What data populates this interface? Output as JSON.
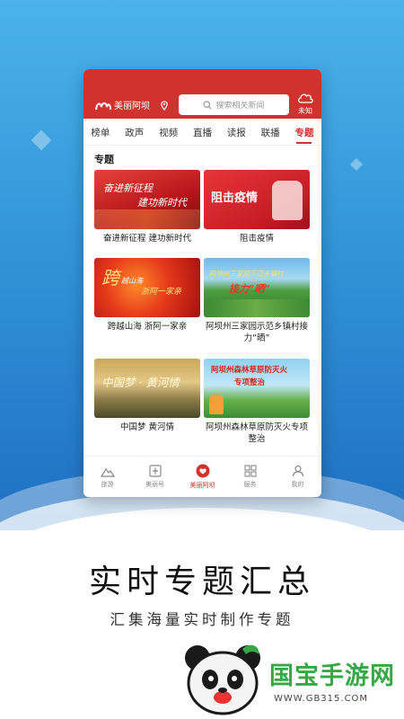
{
  "app": {
    "logo_text": "美丽阿坝",
    "search_placeholder": "搜索相关新闻",
    "weather_text": "未知"
  },
  "tabs": [
    {
      "label": "榜单"
    },
    {
      "label": "政声"
    },
    {
      "label": "视频"
    },
    {
      "label": "直播"
    },
    {
      "label": "读报"
    },
    {
      "label": "联播"
    },
    {
      "label": "专题",
      "active": true
    }
  ],
  "section_title": "专题",
  "cards": [
    {
      "caption": "奋进新征程 建功新时代",
      "thumb_text": [
        "奋进新征程",
        "建功新时代"
      ]
    },
    {
      "caption": "阻击疫情",
      "thumb_text": [
        "阻击疫情"
      ]
    },
    {
      "caption": "跨越山海 浙阿一家亲",
      "thumb_text": [
        "跨",
        "越山海",
        "浙阿一家亲"
      ]
    },
    {
      "caption": "阿坝州三家园示范乡镇村接力“晒”",
      "thumb_text": [
        "阿坝州三家园示范乡镇村",
        "接力“晒”"
      ]
    },
    {
      "caption": "中国梦 黄河情",
      "thumb_text": [
        "中国梦 · 黄河情"
      ]
    },
    {
      "caption": "阿坝州森林草原防灭火专项整治",
      "thumb_text": [
        "阿坝州森林草原防灭火",
        "专项整治"
      ]
    }
  ],
  "bottom_nav": [
    {
      "label": "旅游",
      "icon": "mountain-icon"
    },
    {
      "label": "美丽号",
      "icon": "star-box-icon"
    },
    {
      "label": "美丽阿坝",
      "icon": "heart-icon",
      "active": true
    },
    {
      "label": "服务",
      "icon": "grid-icon"
    },
    {
      "label": "我的",
      "icon": "person-icon"
    }
  ],
  "headline": "实时专题汇总",
  "subline": "汇集海量实时制作专题",
  "watermark": {
    "brand": "国宝手游网",
    "url": "WWW.GB315.COM"
  },
  "colors": {
    "brand_red": "#d0322d",
    "sky_blue": "#3a9fe0",
    "watermark_green": "#36a845"
  }
}
